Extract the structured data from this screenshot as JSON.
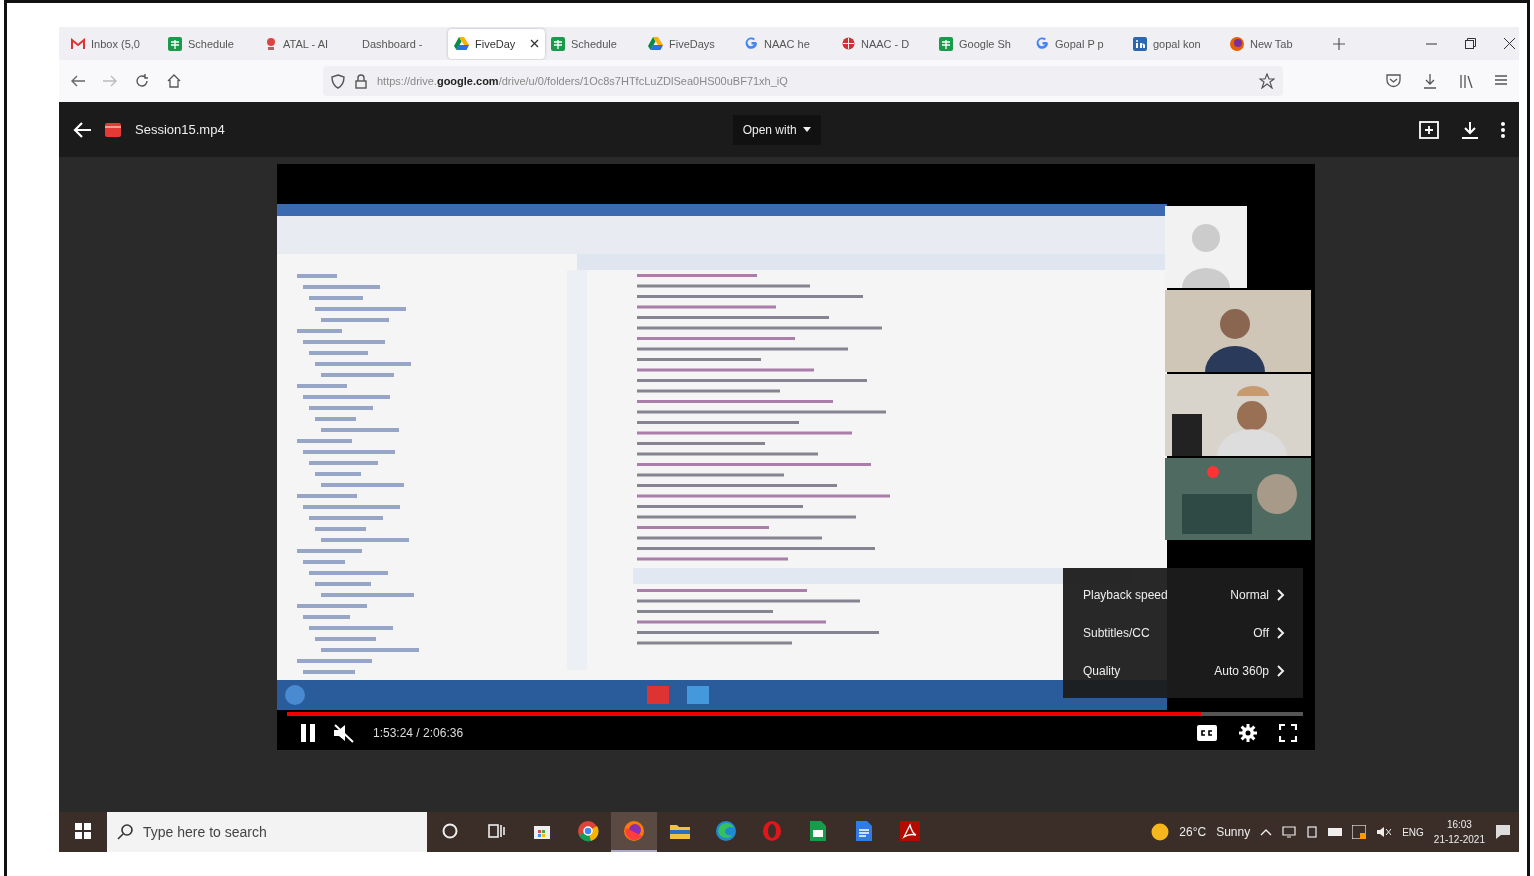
{
  "browser": {
    "tabs": [
      {
        "label": "Inbox (5,0",
        "kind": "gmail",
        "selected": false
      },
      {
        "label": "Schedule",
        "kind": "sheets",
        "selected": false
      },
      {
        "label": "ATAL - AI",
        "kind": "atal",
        "selected": false
      },
      {
        "label": "Dashboard - ",
        "kind": "none",
        "selected": false
      },
      {
        "label": "FiveDay",
        "kind": "drive",
        "selected": true
      },
      {
        "label": "Schedule",
        "kind": "sheets",
        "selected": false
      },
      {
        "label": "FiveDays",
        "kind": "drive",
        "selected": false
      },
      {
        "label": "NAAC he",
        "kind": "google",
        "selected": false
      },
      {
        "label": "NAAC - D",
        "kind": "naac",
        "selected": false
      },
      {
        "label": "Google Sh",
        "kind": "sheets",
        "selected": false
      },
      {
        "label": "Gopal P p",
        "kind": "google",
        "selected": false
      },
      {
        "label": "gopal kon",
        "kind": "linkedin",
        "selected": false
      },
      {
        "label": "New Tab",
        "kind": "firefox",
        "selected": false
      }
    ],
    "url": "https://drive.**google.com**/drive/u/0/folders/1Oc8s7HTfcLuZDlSea0HS00uBF71xh_iQ"
  },
  "viewer": {
    "file_name": "Session15.mp4",
    "open_with": "Open with"
  },
  "player": {
    "playing": true,
    "muted": true,
    "time": "1:53:24 / 2:06:36",
    "progress": {
      "level": 0.9
    },
    "settings_menu": [
      {
        "label": "Playback speed",
        "value": "Normal"
      },
      {
        "label": "Subtitles/CC",
        "value": "Off"
      },
      {
        "label": "Quality",
        "value": "Auto 360p"
      }
    ]
  },
  "taskbar": {
    "search": {
      "placeholder": "Type here to search"
    },
    "apps": [
      {
        "kind": "cortana",
        "selected": false
      },
      {
        "kind": "taskview",
        "selected": false
      },
      {
        "kind": "store",
        "selected": false
      },
      {
        "kind": "chrome",
        "selected": false
      },
      {
        "kind": "firefox",
        "selected": true
      },
      {
        "kind": "explorer",
        "selected": false
      },
      {
        "kind": "edge",
        "selected": false
      },
      {
        "kind": "opera",
        "selected": false
      },
      {
        "kind": "sheets",
        "selected": false
      },
      {
        "kind": "docs",
        "selected": false
      },
      {
        "kind": "acrobat",
        "selected": false
      }
    ],
    "weather": "26°C",
    "condition": "Sunny",
    "language": "ENG",
    "time": "16:03",
    "date": "21-12-2021"
  }
}
